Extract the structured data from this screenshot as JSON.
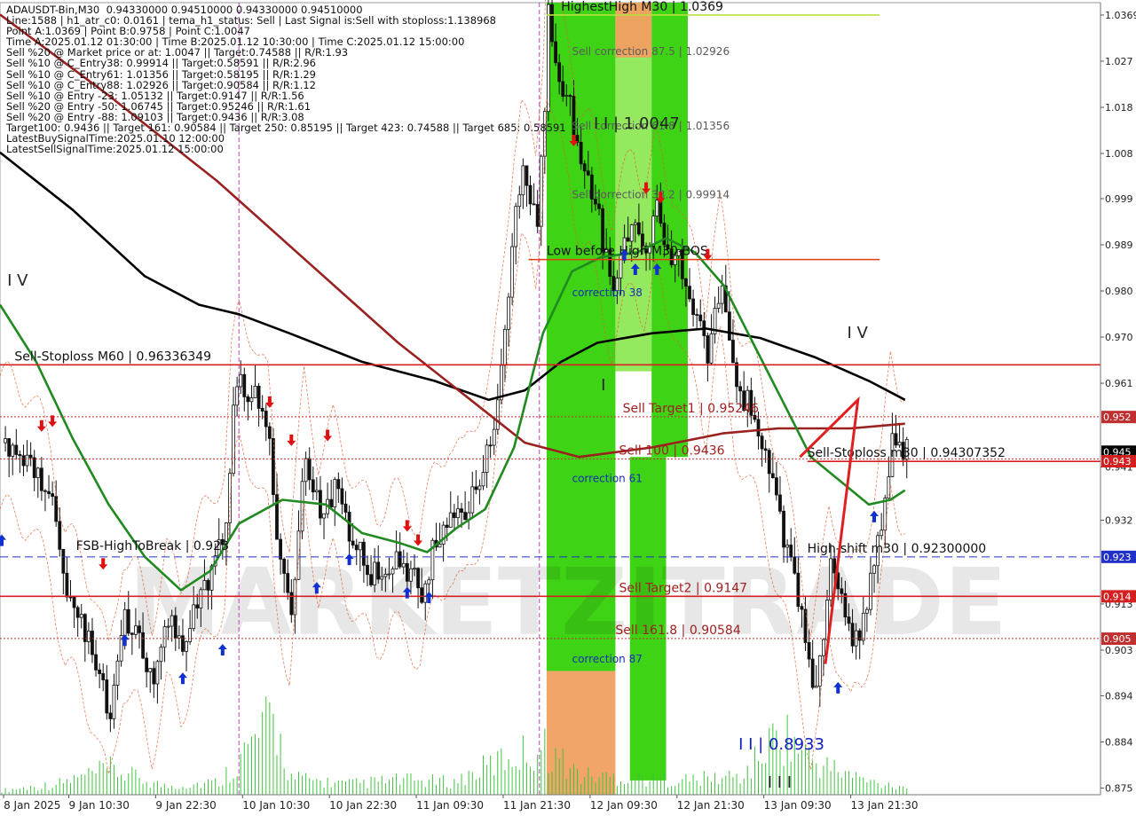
{
  "info_lines": [
    "ADAUSDT-Bin,M30  0.94330000 0.94510000 0.94330000 0.94510000",
    "Line:1588 | h1_atr_c0: 0.0161 | tema_h1_status: Sell | Last Signal is:Sell with stoploss:1.138968",
    "Point A:1.0369 | Point B:0.9758 | Point C:1.0047",
    "Time A:2025.01.12 01:30:00 | Time B:2025.01.12 10:30:00 | Time C:2025.01.12 15:00:00",
    "Sell %20 @ Market price or at: 1.0047 || Target:0.74588 || R/R:1.93",
    "Sell %10 @ C_Entry38: 0.99914 || Target:0.58591 || R/R:2.96",
    "Sell %10 @ C_Entry61: 1.01356 || Target:0.58195 || R/R:1.29",
    "Sell %10 @ C_Entry88: 1.02926 || Target:0.90584 || R/R:1.12",
    "Sell %10 @ Entry -23: 1.05132 || Target:0.9147 || R/R:1.56",
    "Sell %20 @ Entry -50: 1.06745 || Target:0.95246 || R/R:1.61",
    "Sell %20 @ Entry -88: 1.09103 || Target:0.9436 || R/R:3.08",
    "Target100: 0.9436 || Target 161: 0.90584 || Target 250: 0.85195 || Target 423: 0.74588 || Target 685: 0.58591",
    "LatestBuySignalTime:2025.01.10 12:00:00",
    "LatestSellSignalTime:2025.01.12 15:00:00"
  ],
  "chart_data": {
    "type": "candlestick",
    "symbol": "ADAUSDT-Bin",
    "timeframe": "M30",
    "ylim": [
      0.873,
      1.0395
    ],
    "y_ticks": [
      {
        "value": 1.0369,
        "label": "1.0369"
      },
      {
        "value": 1.0272,
        "label": "1.027"
      },
      {
        "value": 1.0175,
        "label": "1.018"
      },
      {
        "value": 1.0078,
        "label": "1.008"
      },
      {
        "value": 0.9983,
        "label": "0.999"
      },
      {
        "value": 0.9886,
        "label": "0.989"
      },
      {
        "value": 0.9789,
        "label": "0.980"
      },
      {
        "value": 0.9692,
        "label": "0.970"
      },
      {
        "value": 0.9595,
        "label": "0.961"
      },
      {
        "value": 0.9419,
        "label": "0.941"
      },
      {
        "value": 0.9307,
        "label": "0.932"
      },
      {
        "value": 0.9131,
        "label": "0.913"
      },
      {
        "value": 0.9034,
        "label": "0.903"
      },
      {
        "value": 0.8938,
        "label": "0.894"
      },
      {
        "value": 0.8841,
        "label": "0.884"
      },
      {
        "value": 0.8744,
        "label": "0.875"
      }
    ],
    "x_ticks": [
      {
        "index": 1,
        "label": "8 Jan 2025"
      },
      {
        "index": 19,
        "label": "9 Jan 10:30"
      },
      {
        "index": 43,
        "label": "9 Jan 22:30"
      },
      {
        "index": 67,
        "label": "10 Jan 10:30"
      },
      {
        "index": 91,
        "label": "10 Jan 22:30"
      },
      {
        "index": 115,
        "label": "11 Jan 09:30"
      },
      {
        "index": 139,
        "label": "11 Jan 21:30"
      },
      {
        "index": 163,
        "label": "12 Jan 09:30"
      },
      {
        "index": 187,
        "label": "12 Jan 21:30"
      },
      {
        "index": 211,
        "label": "13 Jan 09:30"
      },
      {
        "index": 235,
        "label": "13 Jan 21:30"
      }
    ],
    "x_range": [
      0,
      304
    ],
    "close_path": [
      [
        0,
        0.947
      ],
      [
        8,
        0.944
      ],
      [
        14,
        0.933
      ],
      [
        18,
        0.914
      ],
      [
        22,
        0.91
      ],
      [
        26,
        0.902
      ],
      [
        30,
        0.888
      ],
      [
        34,
        0.91
      ],
      [
        38,
        0.905
      ],
      [
        42,
        0.896
      ],
      [
        46,
        0.91
      ],
      [
        50,
        0.903
      ],
      [
        54,
        0.915
      ],
      [
        58,
        0.92
      ],
      [
        62,
        0.928
      ],
      [
        64,
        0.952
      ],
      [
        66,
        0.96
      ],
      [
        70,
        0.956
      ],
      [
        74,
        0.946
      ],
      [
        76,
        0.928
      ],
      [
        80,
        0.912
      ],
      [
        84,
        0.946
      ],
      [
        88,
        0.93
      ],
      [
        92,
        0.937
      ],
      [
        96,
        0.929
      ],
      [
        100,
        0.922
      ],
      [
        104,
        0.918
      ],
      [
        108,
        0.923
      ],
      [
        112,
        0.92
      ],
      [
        116,
        0.916
      ],
      [
        120,
        0.926
      ],
      [
        124,
        0.934
      ],
      [
        128,
        0.93
      ],
      [
        132,
        0.94
      ],
      [
        136,
        0.948
      ],
      [
        138,
        0.962
      ],
      [
        140,
        0.979
      ],
      [
        142,
        0.996
      ],
      [
        144,
        1.004
      ],
      [
        146,
        0.998
      ],
      [
        148,
        0.993
      ],
      [
        150,
        1.016
      ],
      [
        151,
        1.0369
      ],
      [
        154,
        1.024
      ],
      [
        157,
        1.017
      ],
      [
        160,
        1.005
      ],
      [
        163,
        1.0
      ],
      [
        166,
        0.99
      ],
      [
        169,
        0.981
      ],
      [
        172,
        0.988
      ],
      [
        175,
        0.994
      ],
      [
        178,
        0.988
      ],
      [
        181,
        0.996
      ],
      [
        184,
        0.988
      ],
      [
        187,
        0.986
      ],
      [
        190,
        0.9758
      ],
      [
        193,
        0.97
      ],
      [
        195,
        0.963
      ],
      [
        197,
        0.976
      ],
      [
        199,
        0.982
      ],
      [
        201,
        0.97
      ],
      [
        203,
        0.96
      ],
      [
        206,
        0.955
      ],
      [
        209,
        0.948
      ],
      [
        212,
        0.94
      ],
      [
        215,
        0.93
      ],
      [
        218,
        0.92
      ],
      [
        221,
        0.91
      ],
      [
        224,
        0.8933
      ],
      [
        226,
        0.9
      ],
      [
        229,
        0.92
      ],
      [
        232,
        0.915
      ],
      [
        235,
        0.905
      ],
      [
        238,
        0.91
      ],
      [
        241,
        0.92
      ],
      [
        244,
        0.934
      ],
      [
        246,
        0.95
      ],
      [
        248,
        0.946
      ],
      [
        250,
        0.9451
      ]
    ],
    "volume_profile": [
      [
        0,
        0.02
      ],
      [
        15,
        0.05
      ],
      [
        30,
        0.12
      ],
      [
        45,
        0.04
      ],
      [
        60,
        0.06
      ],
      [
        75,
        0.35
      ],
      [
        80,
        0.08
      ],
      [
        95,
        0.05
      ],
      [
        110,
        0.07
      ],
      [
        125,
        0.06
      ],
      [
        140,
        0.18
      ],
      [
        150,
        0.22
      ],
      [
        160,
        0.09
      ],
      [
        175,
        0.08
      ],
      [
        190,
        0.07
      ],
      [
        205,
        0.09
      ],
      [
        215,
        0.3
      ],
      [
        225,
        0.15
      ],
      [
        240,
        0.06
      ],
      [
        250,
        0.04
      ]
    ],
    "series": [
      {
        "name": "",
        "color": "#000000",
        "points": [
          [
            0,
            1.008
          ],
          [
            20,
            0.996
          ],
          [
            40,
            0.982
          ],
          [
            55,
            0.976
          ],
          [
            66,
            0.974
          ],
          [
            80,
            0.97
          ],
          [
            100,
            0.964
          ],
          [
            120,
            0.96
          ],
          [
            135,
            0.956
          ],
          [
            145,
            0.958
          ],
          [
            155,
            0.964
          ],
          [
            165,
            0.968
          ],
          [
            180,
            0.97
          ],
          [
            195,
            0.971
          ],
          [
            210,
            0.969
          ],
          [
            225,
            0.965
          ],
          [
            240,
            0.96
          ],
          [
            250,
            0.956
          ]
        ]
      },
      {
        "name": "",
        "color": "#9b2020",
        "points": [
          [
            0,
            1.037
          ],
          [
            30,
            1.02
          ],
          [
            60,
            1.002
          ],
          [
            85,
            0.985
          ],
          [
            110,
            0.968
          ],
          [
            130,
            0.956
          ],
          [
            145,
            0.947
          ],
          [
            160,
            0.944
          ],
          [
            180,
            0.946
          ],
          [
            200,
            0.949
          ],
          [
            215,
            0.95
          ],
          [
            235,
            0.95
          ],
          [
            250,
            0.951
          ]
        ]
      },
      {
        "name": "",
        "color": "#1f8a1f",
        "points": [
          [
            0,
            0.976
          ],
          [
            10,
            0.964
          ],
          [
            20,
            0.948
          ],
          [
            30,
            0.934
          ],
          [
            40,
            0.923
          ],
          [
            50,
            0.916
          ],
          [
            58,
            0.92
          ],
          [
            66,
            0.93
          ],
          [
            78,
            0.935
          ],
          [
            90,
            0.934
          ],
          [
            100,
            0.928
          ],
          [
            110,
            0.926
          ],
          [
            118,
            0.924
          ],
          [
            126,
            0.929
          ],
          [
            134,
            0.933
          ],
          [
            142,
            0.946
          ],
          [
            150,
            0.97
          ],
          [
            158,
            0.983
          ],
          [
            166,
            0.986
          ],
          [
            176,
            0.987
          ],
          [
            184,
            0.99
          ],
          [
            192,
            0.987
          ],
          [
            200,
            0.98
          ],
          [
            208,
            0.968
          ],
          [
            216,
            0.956
          ],
          [
            224,
            0.944
          ],
          [
            232,
            0.939
          ],
          [
            240,
            0.934
          ],
          [
            246,
            0.935
          ],
          [
            250,
            0.937
          ]
        ]
      }
    ],
    "shaded_bands": [
      {
        "color": "#35d10a",
        "x0": 151,
        "x1": 170,
        "y0": 0.899,
        "y1": 1.0395
      },
      {
        "color": "#8fe855",
        "x0": 170,
        "x1": 180,
        "y0": 0.962,
        "y1": 1.0395
      },
      {
        "color": "#35d10a",
        "x0": 180,
        "x1": 190,
        "y0": 0.944,
        "y1": 1.0395
      },
      {
        "color": "#35d10a",
        "x0": 174,
        "x1": 184,
        "y0": 0.876,
        "y1": 0.944
      },
      {
        "color": "#f0a060",
        "x0": 170,
        "x1": 180,
        "y0": 1.028,
        "y1": 1.0395
      },
      {
        "color": "#f0a060",
        "x0": 151,
        "x1": 170,
        "y0": 0.873,
        "y1": 0.899
      }
    ],
    "levels": [
      {
        "name": "Sell-Stoploss M60",
        "value": 0.96336349,
        "label": "Sell-Stoploss M60 | 0.96336349",
        "color": "#d42020",
        "style": "solid",
        "x0": 0,
        "x1": 304,
        "label_x": 4
      },
      {
        "name": "Sell-Stoploss m30",
        "value": 0.94307352,
        "label": "Sell-Stoploss m30 | 0.94307352",
        "color": "#d42020",
        "style": "solid",
        "x0": 223,
        "x1": 304,
        "label_x": 223
      },
      {
        "name": "Sell Target1",
        "value": 0.95246,
        "label": "Sell Target1 | 0.95246",
        "color": "#c03030",
        "style": "dotted",
        "x0": 0,
        "x1": 304,
        "label_x": 172
      },
      {
        "name": "Sell 100",
        "value": 0.9436,
        "label": "Sell 100 | 0.9436",
        "color": "#c03030",
        "style": "dotted",
        "x0": 0,
        "x1": 304,
        "label_x": 171
      },
      {
        "name": "High-shift m30",
        "value": 0.923,
        "label": "High-shift m30 | 0.92300000",
        "color": "#2030c8",
        "style": "dashed",
        "x0": 0,
        "x1": 304,
        "label_x": 223
      },
      {
        "name": "FSB-High Break",
        "value": 0.9235,
        "label": "FSB-HighToBreak | 0.923",
        "color": "#2030c8",
        "style": "none",
        "x0": 20,
        "x1": 20,
        "label_x": 21
      },
      {
        "name": "Sell Target2",
        "value": 0.9147,
        "label": "Sell Target2 | 0.9147",
        "color": "#d42020",
        "style": "solid",
        "x0": 0,
        "x1": 304,
        "label_x": 171
      },
      {
        "name": "Sell 161.8",
        "value": 0.90584,
        "label": "Sell 161.8 | 0.90584",
        "color": "#c03030",
        "style": "dotted",
        "x0": 0,
        "x1": 304,
        "label_x": 170
      },
      {
        "name": "HighestHigh M30",
        "value": 1.0369,
        "label": "HighestHigh   M30 | 1.0369",
        "color": "#b8e040",
        "style": "solid",
        "x0": 151,
        "x1": 243,
        "label_x": 155
      },
      {
        "name": "Low before High M30-BOS",
        "value": 0.9855,
        "label": "Low before High   M30-BOS",
        "color": "#e04010",
        "style": "solid",
        "x0": 146,
        "x1": 243,
        "label_x": 151
      }
    ],
    "fib_labels": [
      {
        "label": "Sell correction 87.5 | 1.02926",
        "value": 1.02926,
        "x": 158
      },
      {
        "label": "Sell correction 61.8 | 1.01356",
        "value": 1.01356,
        "x": 158
      },
      {
        "label": "Sell correction 38.2 | 0.99914",
        "value": 0.99914,
        "x": 158
      }
    ],
    "zone_labels": [
      {
        "label": "correction 38",
        "value": 0.9785,
        "x": 158
      },
      {
        "label": "correction 61",
        "value": 0.9395,
        "x": 158
      },
      {
        "label": "correction 87",
        "value": 0.9015,
        "x": 158
      }
    ],
    "wave_labels": [
      {
        "label": "I V",
        "value": 0.98,
        "x": 2,
        "color": "#222222",
        "size": 18
      },
      {
        "label": "I I | 1.0047",
        "value": 1.013,
        "x": 164,
        "color": "#222222",
        "size": 18
      },
      {
        "label": "I",
        "value": 0.958,
        "x": 166,
        "color": "#222222",
        "size": 18
      },
      {
        "label": "I V",
        "value": 0.969,
        "x": 234,
        "color": "#222222",
        "size": 18
      },
      {
        "label": "I I | 0.8933",
        "value": 0.8825,
        "x": 204,
        "color": "#1020c0",
        "size": 18
      },
      {
        "label": "I I I",
        "value": 0.8745,
        "x": 212,
        "color": "#222222",
        "size": 18
      }
    ],
    "abc_triangle": [
      [
        221,
        0.944
      ],
      [
        237,
        0.956
      ],
      [
        228,
        0.9005
      ]
    ],
    "right_labels": [
      {
        "value": 0.9524,
        "label": "0.952",
        "bg": "#c03030"
      },
      {
        "value": 0.9451,
        "label": "0.945",
        "bg": "#000000"
      },
      {
        "value": 0.9431,
        "label": "0.943",
        "bg": "#d42020"
      },
      {
        "value": 0.923,
        "label": "0.923",
        "bg": "#2030c8"
      },
      {
        "value": 0.9147,
        "label": "0.914",
        "bg": "#d42020"
      },
      {
        "value": 0.9058,
        "label": "0.905",
        "bg": "#c03030"
      }
    ],
    "vertical_lines": [
      {
        "x": 66,
        "color": "#c040c0"
      },
      {
        "x": 149,
        "color": "#c040c0"
      }
    ],
    "buy_arrows": [
      [
        0,
        0.929
      ],
      [
        34,
        0.908
      ],
      [
        50,
        0.9
      ],
      [
        61,
        0.906
      ],
      [
        87,
        0.919
      ],
      [
        96,
        0.925
      ],
      [
        112,
        0.918
      ],
      [
        118,
        0.917
      ],
      [
        172,
        0.989
      ],
      [
        175,
        0.986
      ],
      [
        181,
        0.986
      ],
      [
        231,
        0.898
      ],
      [
        241,
        0.934
      ]
    ],
    "sell_arrows": [
      [
        11,
        0.948
      ],
      [
        14,
        0.949
      ],
      [
        28,
        0.919
      ],
      [
        74,
        0.953
      ],
      [
        80,
        0.945
      ],
      [
        90,
        0.946
      ],
      [
        112,
        0.927
      ],
      [
        115,
        0.924
      ],
      [
        158,
        1.008
      ],
      [
        178,
        0.998
      ],
      [
        182,
        0.996
      ],
      [
        195,
        0.984
      ]
    ],
    "watermark": "MARKETZITRADE"
  }
}
